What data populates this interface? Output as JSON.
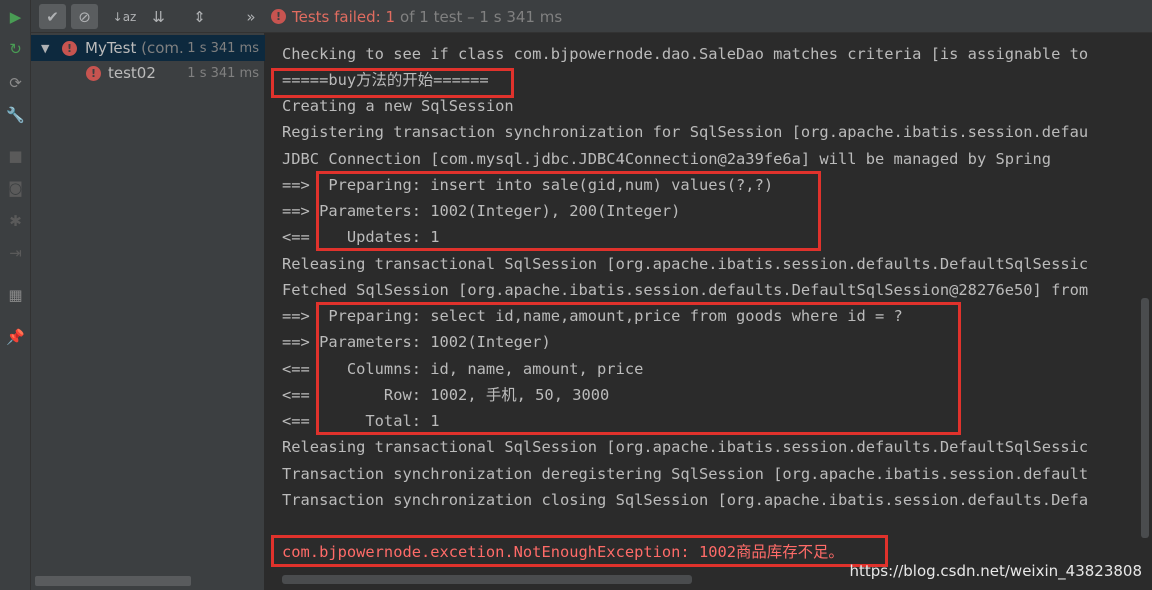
{
  "toolbar": {
    "buttons": [
      {
        "name": "show-passed-toggle",
        "glyph": "✔"
      },
      {
        "name": "show-ignored-toggle",
        "glyph": "⊘"
      },
      {
        "name": "sort-alphabetically-button",
        "glyph": "↓az"
      },
      {
        "name": "sort-by-duration-button",
        "glyph": "⇊"
      },
      {
        "name": "expand-all-button",
        "glyph": "⇕"
      },
      {
        "name": "more-button",
        "glyph": "»"
      }
    ],
    "status_failed": "Tests failed: 1",
    "status_rest": "of 1 test – 1 s 341 ms",
    "status_icon": "!"
  },
  "strip": {
    "icons": [
      {
        "name": "run-icon",
        "glyph": "▶"
      },
      {
        "name": "rerun-failed-icon",
        "glyph": "↻"
      },
      {
        "name": "toggle-auto-test-icon",
        "glyph": "⟳"
      },
      {
        "name": "wrench-icon",
        "glyph": "🔧"
      },
      {
        "name": "stop-icon",
        "glyph": "■"
      },
      {
        "name": "camera-icon",
        "glyph": "◙"
      },
      {
        "name": "debug-icon",
        "glyph": "✱"
      },
      {
        "name": "exit-icon",
        "glyph": "⇥"
      },
      {
        "name": "layout-icon",
        "glyph": "▦"
      },
      {
        "name": "pin-icon",
        "glyph": "📌"
      }
    ]
  },
  "tree": {
    "root": {
      "name": "MyTest",
      "pkg": "(com.b",
      "time": "1 s 341 ms"
    },
    "child": {
      "name": "test02",
      "time": "1 s 341 ms"
    }
  },
  "console": {
    "lines": [
      "Checking to see if class com.bjpowernode.dao.SaleDao matches criteria [is assignable to",
      "=====buy方法的开始======",
      "Creating a new SqlSession",
      "Registering transaction synchronization for SqlSession [org.apache.ibatis.session.defau",
      "JDBC Connection [com.mysql.jdbc.JDBC4Connection@2a39fe6a] will be managed by Spring",
      "==>  Preparing: insert into sale(gid,num) values(?,?)",
      "==> Parameters: 1002(Integer), 200(Integer)",
      "<==    Updates: 1",
      "Releasing transactional SqlSession [org.apache.ibatis.session.defaults.DefaultSqlSessic",
      "Fetched SqlSession [org.apache.ibatis.session.defaults.DefaultSqlSession@28276e50] from",
      "==>  Preparing: select id,name,amount,price from goods where id = ?",
      "==> Parameters: 1002(Integer)",
      "<==    Columns: id, name, amount, price",
      "<==        Row: 1002, 手机, 50, 3000",
      "<==      Total: 1",
      "Releasing transactional SqlSession [org.apache.ibatis.session.defaults.DefaultSqlSessic",
      "Transaction synchronization deregistering SqlSession [org.apache.ibatis.session.default",
      "Transaction synchronization closing SqlSession [org.apache.ibatis.session.defaults.Defa",
      "",
      "com.bjpowernode.excetion.NotEnoughException: 1002商品库存不足。"
    ],
    "error_line_index": 19
  },
  "watermark": "https://blog.csdn.net/weixin_43823808",
  "colors": {
    "error": "#ff6b68",
    "highlight": "#e0322c",
    "run_green": "#499c54"
  }
}
